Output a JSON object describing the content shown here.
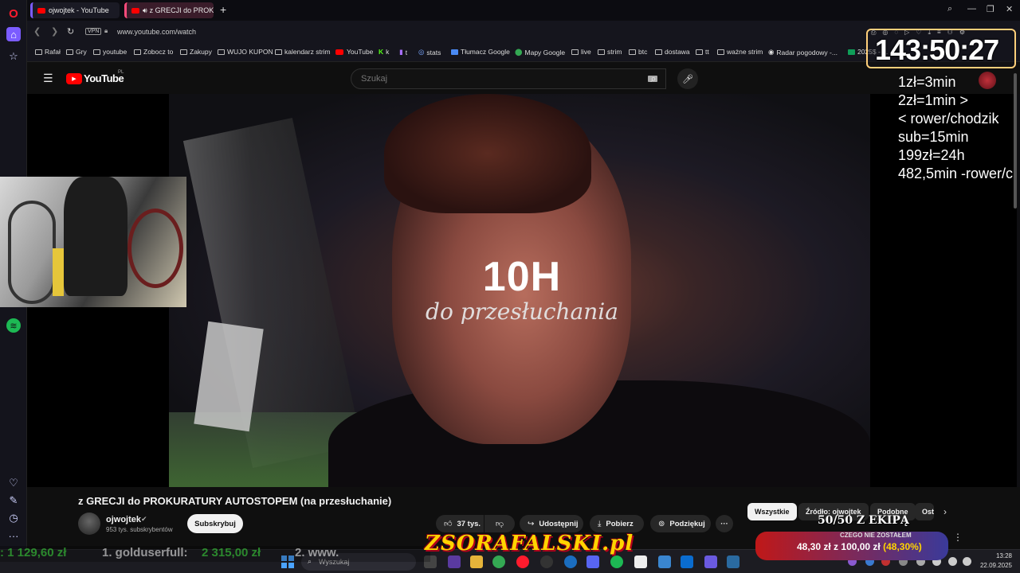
{
  "tabs": [
    {
      "label": "ojwojtek - YouTube"
    },
    {
      "label": "z GRECJI do PROKURA"
    }
  ],
  "address": {
    "vpn": "VPN",
    "url": "www.youtube.com/watch"
  },
  "bookmarks": [
    "Rafał",
    "Gry",
    "youtube",
    "Zobocz to",
    "Zakupy",
    "WUJO KUPON",
    "kalendarz strim",
    "YouTube",
    "k",
    "t",
    "stats",
    "Tłumacz Google",
    "Mapy Google",
    "live",
    "strim",
    "btc",
    "dostawa",
    "tt",
    "ważne strim",
    "Radar pogodowy -...",
    "2025$ - ..."
  ],
  "youtube": {
    "logo": "YouTube",
    "region": "PL",
    "search_placeholder": "Szukaj"
  },
  "video": {
    "overlay_title": "10H",
    "overlay_subtitle": "do przesłuchania",
    "title": "z GRECJI do PROKURATURY AUTOSTOPEM (na przesłuchanie)"
  },
  "channel": {
    "name": "ojwojtek",
    "subscribers": "953 tys. subskrybentów",
    "subscribe_label": "Subskrybuj"
  },
  "actions": {
    "likes": "37 tys.",
    "share": "Udostępnij",
    "download": "Pobierz",
    "thanks": "Podziękuj"
  },
  "chips": [
    "Wszystkie",
    "Źródło: ojwojtek",
    "Podobne",
    "Ost"
  ],
  "stream_overlay": {
    "timer": "143:50:27",
    "rules": [
      "1zł=3min",
      "2zł=1min >",
      "< rower/chodzik",
      "sub=15min",
      "199zł=24h",
      "482,5min -rower/c"
    ],
    "ticker_amount_1": ": 1 129,60 zł",
    "ticker_user": "1. golduserfull:",
    "ticker_amount_2": "2 315,00 zł",
    "ticker_next": "2. www.",
    "logo": "ZSORAFALSKI.pl",
    "goal_label": "50/50 Z EKIPĄ",
    "goal_top_text": "CZEGO NIE ZOSTAŁEM",
    "goal_amount": "48,30 zł",
    "goal_of": "z",
    "goal_target": "100,00 zł",
    "goal_percent": "(48,30%)"
  },
  "taskbar": {
    "search_placeholder": "Wyszukaj",
    "time": "13:28",
    "date": "22.09.2025"
  }
}
